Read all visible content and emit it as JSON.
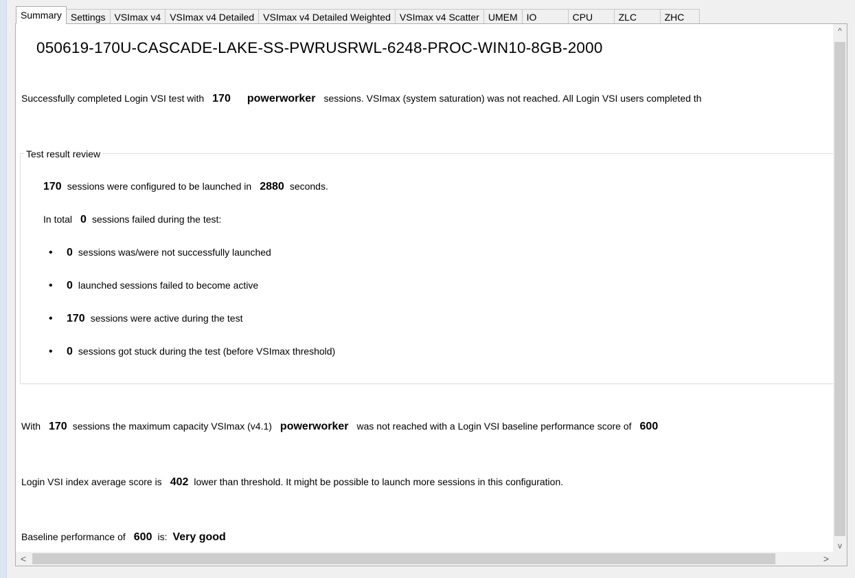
{
  "tabs": [
    {
      "label": "Summary"
    },
    {
      "label": "Settings"
    },
    {
      "label": "VSImax v4"
    },
    {
      "label": "VSImax v4 Detailed"
    },
    {
      "label": "VSImax v4 Detailed Weighted"
    },
    {
      "label": "VSImax v4 Scatter"
    },
    {
      "label": "UMEM"
    },
    {
      "label": "IO"
    },
    {
      "label": "CPU"
    },
    {
      "label": "ZLC"
    },
    {
      "label": "ZHC"
    }
  ],
  "active_tab": "Summary",
  "title": "050619-170U-CASCADE-LAKE-SS-PWRUSRWL-6248-PROC-WIN10-8GB-2000",
  "summary": {
    "prefix": "Successfully completed Login VSI test with",
    "sessions": "170",
    "workload": "powerworker",
    "suffix": "sessions. VSImax (system saturation) was not reached. All Login VSI users completed th"
  },
  "review": {
    "legend": "Test result review",
    "configured_sessions": "170",
    "configured_text": "sessions were configured to be launched in",
    "seconds_value": "2880",
    "seconds_label": "seconds.",
    "failed_prefix": "In total",
    "failed_value": "0",
    "failed_text": "sessions failed during the test:",
    "bullets": [
      {
        "value": "0",
        "text": "sessions was/were not successfully launched"
      },
      {
        "value": "0",
        "text": "launched sessions failed to become active"
      },
      {
        "value": "170",
        "text": "sessions were active during the test"
      },
      {
        "value": "0",
        "text": "sessions got stuck during the test (before VSImax threshold)"
      }
    ]
  },
  "capacity": {
    "prefix": "With",
    "sessions": "170",
    "middle": "sessions the maximum capacity VSImax (v4.1)",
    "workload": "powerworker",
    "suffix": "was not reached with a Login VSI baseline performance score of",
    "score": "600"
  },
  "index": {
    "prefix": "Login VSI index average score is",
    "score": "402",
    "suffix": "lower than threshold. It might be possible to launch more sessions in this configuration."
  },
  "baseline": {
    "prefix": "Baseline performance of",
    "score": "600",
    "middle": "is:",
    "rating": "Very good"
  },
  "scrollbars": {
    "up_icon": "scroll-up-arrow-icon",
    "down_icon": "scroll-down-arrow-icon",
    "left_icon": "scroll-left-arrow-icon",
    "right_icon": "scroll-right-arrow-icon"
  }
}
